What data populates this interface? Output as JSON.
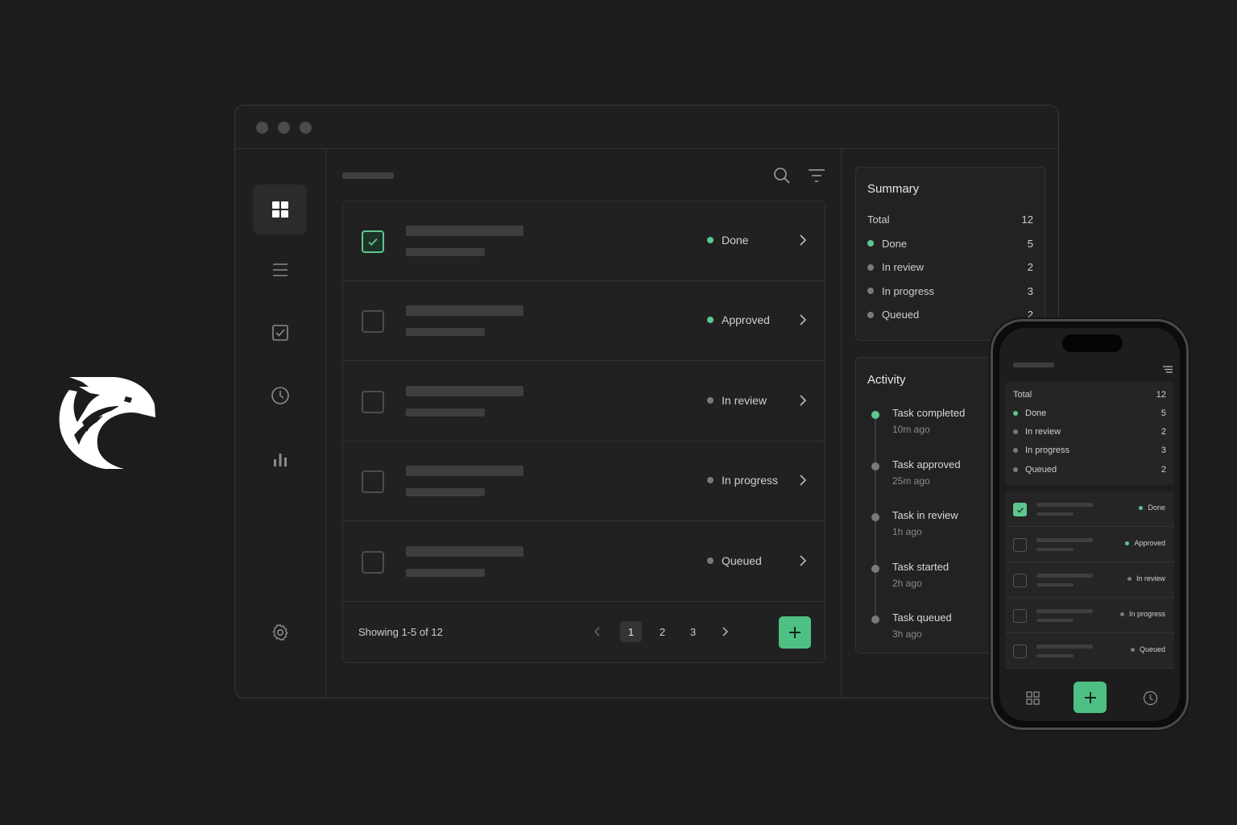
{
  "brand": {
    "logo_icon": "eagle-head-logo"
  },
  "window": {
    "controls": [
      "window-dot",
      "window-dot",
      "window-dot"
    ]
  },
  "sidebar": {
    "items": [
      {
        "icon": "grid-icon",
        "active": true
      },
      {
        "icon": "list-icon",
        "active": false
      },
      {
        "icon": "checkbox-icon",
        "active": false
      },
      {
        "icon": "clock-icon",
        "active": false
      },
      {
        "icon": "bar-chart-icon",
        "active": false
      }
    ],
    "settings_icon": "gear-icon"
  },
  "toolbar": {
    "search_icon": "search-icon",
    "filter_icon": "filter-icon"
  },
  "tasks": [
    {
      "checked": true,
      "status": "Done",
      "status_color": "#5fc690"
    },
    {
      "checked": false,
      "status": "Approved",
      "status_color": "#5fc690"
    },
    {
      "checked": false,
      "status": "In review",
      "status_color": "#7a7a7c"
    },
    {
      "checked": false,
      "status": "In progress",
      "status_color": "#7a7a7c"
    },
    {
      "checked": false,
      "status": "Queued",
      "status_color": "#7a7a7c"
    }
  ],
  "pagination": {
    "showing": "Showing 1-5 of 12",
    "pages": [
      "1",
      "2",
      "3"
    ],
    "current": "1"
  },
  "summary": {
    "title": "Summary",
    "total_label": "Total",
    "total_value": "12",
    "rows": [
      {
        "label": "Done",
        "value": "5",
        "color": "#5fc690"
      },
      {
        "label": "In review",
        "value": "2",
        "color": "#7a7a7c"
      },
      {
        "label": "In progress",
        "value": "3",
        "color": "#7a7a7c"
      },
      {
        "label": "Queued",
        "value": "2",
        "color": "#7a7a7c"
      }
    ]
  },
  "activity": {
    "title": "Activity",
    "items": [
      {
        "title": "Task completed",
        "time": "10m ago",
        "color": "#5fc690"
      },
      {
        "title": "Task approved",
        "time": "25m ago",
        "color": "#7a7a7c"
      },
      {
        "title": "Task in review",
        "time": "1h ago",
        "color": "#7a7a7c"
      },
      {
        "title": "Task started",
        "time": "2h ago",
        "color": "#7a7a7c"
      },
      {
        "title": "Task queued",
        "time": "3h ago",
        "color": "#7a7a7c"
      }
    ]
  },
  "mobile": {
    "summary": {
      "total_label": "Total",
      "total_value": "12",
      "rows": [
        {
          "label": "Done",
          "value": "5",
          "color": "#5fc690"
        },
        {
          "label": "In review",
          "value": "2",
          "color": "#7a7a7c"
        },
        {
          "label": "In progress",
          "value": "3",
          "color": "#7a7a7c"
        },
        {
          "label": "Queued",
          "value": "2",
          "color": "#7a7a7c"
        }
      ]
    },
    "tasks": [
      {
        "checked": true,
        "status": "Done",
        "status_color": "#5fc690"
      },
      {
        "checked": false,
        "status": "Approved",
        "status_color": "#5fc690"
      },
      {
        "checked": false,
        "status": "In review",
        "status_color": "#7a7a7c"
      },
      {
        "checked": false,
        "status": "In progress",
        "status_color": "#7a7a7c"
      },
      {
        "checked": false,
        "status": "Queued",
        "status_color": "#7a7a7c"
      }
    ],
    "tab_icons": [
      "grid-icon",
      "plus-icon",
      "clock-icon"
    ]
  },
  "colors": {
    "accent": "#4fc083",
    "background": "#1c1c1d"
  }
}
